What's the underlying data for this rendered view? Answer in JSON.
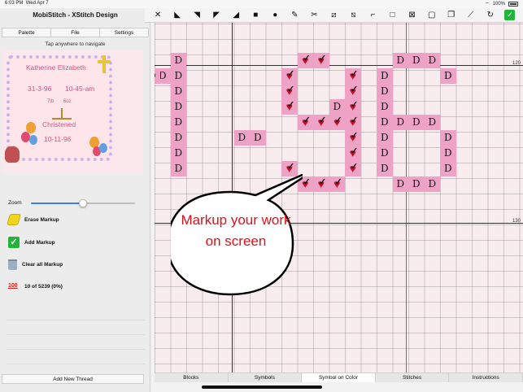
{
  "status_bar": {
    "time": "6:03 PM",
    "date": "Wed Apr 7",
    "battery": "100%"
  },
  "app": {
    "title": "MobiStitch - XStitch Design"
  },
  "menu": [
    "Palette",
    "File",
    "Settings"
  ],
  "hint": "Tap anywhere to navigate",
  "preview": {
    "name": "Katherine Elizabeth",
    "date1": "31-3-96",
    "time1": "10-45-am",
    "weight_lbs": "7lb",
    "weight_oz": "6oz",
    "event": "Christened",
    "date2": "10-11-96"
  },
  "zoom": {
    "label": "Zoom",
    "value": 0.5
  },
  "actions": {
    "erase": "Erase Markup",
    "add": "Add Markup",
    "clear": "Clear all Markup",
    "progress": "10 of 5239  (0%)"
  },
  "add_thread": "Add New Thread",
  "toolbar": [
    {
      "name": "close-icon",
      "glyph": "✕"
    },
    {
      "name": "arrow-nw-icon",
      "glyph": "◣"
    },
    {
      "name": "arrow-se-icon",
      "glyph": "◥"
    },
    {
      "name": "corner-tr-icon",
      "glyph": "◤"
    },
    {
      "name": "triangle-icon",
      "glyph": "◢"
    },
    {
      "name": "fill-square-icon",
      "glyph": "■"
    },
    {
      "name": "circle-icon",
      "glyph": "●"
    },
    {
      "name": "brush-icon",
      "glyph": "✎"
    },
    {
      "name": "scissors-icon",
      "glyph": "✂"
    },
    {
      "name": "pen-icon",
      "glyph": "⧄"
    },
    {
      "name": "diagonal-icon",
      "glyph": "⧅"
    },
    {
      "name": "corner-icon",
      "glyph": "⌐"
    },
    {
      "name": "square-outline-icon",
      "glyph": "□"
    },
    {
      "name": "stamp-icon",
      "glyph": "⊠"
    },
    {
      "name": "select-icon",
      "glyph": "▢"
    },
    {
      "name": "layers-icon",
      "glyph": "❐"
    },
    {
      "name": "eyedropper-icon",
      "glyph": "⟋"
    },
    {
      "name": "redo-icon",
      "glyph": "↻"
    },
    {
      "name": "markup-check-icon",
      "glyph": "✓"
    }
  ],
  "grid": {
    "row_labels": [
      "120",
      "130"
    ],
    "symbol": "D"
  },
  "callout": "Markup your work on screen",
  "tabs": [
    "Blocks",
    "Symbols",
    "Symbol on Color",
    "Stitches",
    "Instructions"
  ],
  "tabs_selected": 2,
  "colors": {
    "cell": "#eea3c6",
    "callout_text": "#e0101a",
    "accent_blue": "#3a7cf5",
    "check_green": "#22b33a"
  }
}
